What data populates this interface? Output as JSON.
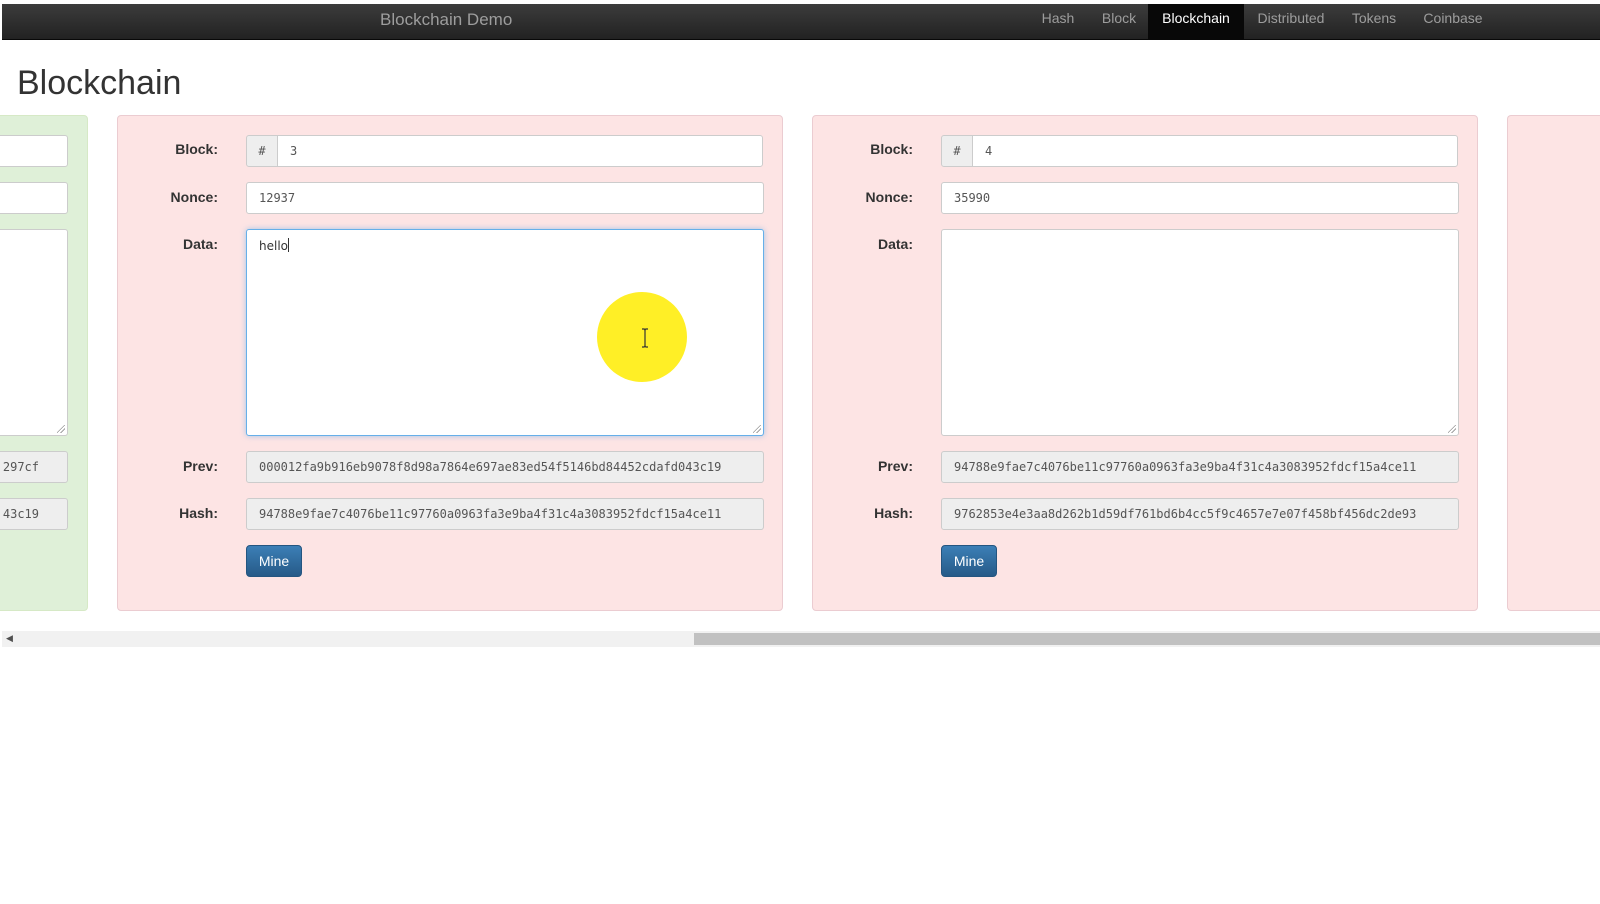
{
  "navbar": {
    "brand": "Blockchain Demo",
    "items": [
      {
        "label": "Hash",
        "active": false
      },
      {
        "label": "Block",
        "active": false
      },
      {
        "label": "Blockchain",
        "active": true
      },
      {
        "label": "Distributed",
        "active": false
      },
      {
        "label": "Tokens",
        "active": false
      },
      {
        "label": "Coinbase",
        "active": false
      }
    ]
  },
  "page": {
    "title": "Blockchain"
  },
  "labels": {
    "block": "Block:",
    "nonce": "Nonce:",
    "data": "Data:",
    "prev": "Prev:",
    "hash": "Hash:",
    "hash_prefix": "#",
    "mine": "Mine"
  },
  "blocks": [
    {
      "status": "valid",
      "prev_partial": "297cf",
      "hash_partial": "43c19"
    },
    {
      "status": "invalid",
      "block": "3",
      "nonce": "12937",
      "data": "hello",
      "prev": "000012fa9b916eb9078f8d98a7864e697ae83ed54f5146bd84452cdafd043c19",
      "hash": "94788e9fae7c4076be11c97760a0963fa3e9ba4f31c4a3083952fdcf15a4ce11"
    },
    {
      "status": "invalid",
      "block": "4",
      "nonce": "35990",
      "data": "",
      "prev": "94788e9fae7c4076be11c97760a0963fa3e9ba4f31c4a3083952fdcf15a4ce11",
      "hash": "9762853e4e3aa8d262b1d59df761bd6b4cc5f9c4657e7e07f458bf456dc2de93"
    },
    {
      "status": "invalid"
    }
  ],
  "colors": {
    "valid_bg": "#dff0d8",
    "invalid_bg": "#fde4e4",
    "button": "#2e6da4",
    "cursor_highlight": "#ffec00"
  }
}
